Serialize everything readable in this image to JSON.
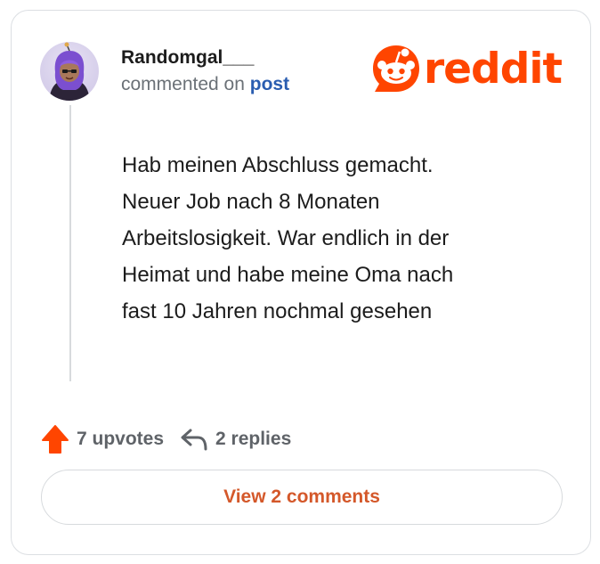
{
  "user": {
    "name": "Randomgal___",
    "subline_prefix": "commented on",
    "subline_link": "post"
  },
  "brand": {
    "logo_text": "reddit",
    "color": "#ff4500"
  },
  "comment": {
    "lines": [
      "Hab meinen Abschluss gemacht.",
      "Neuer Job nach 8 Monaten",
      "Arbeitslosigkeit. War endlich in der",
      "Heimat und habe meine Oma nach",
      "fast 10 Jahren nochmal gesehen"
    ]
  },
  "stats": {
    "upvotes": "7 upvotes",
    "replies": "2 replies",
    "upvote_icon": "upvote-arrow-icon",
    "reply_icon": "reply-arrow-icon",
    "upvote_color": "#ff4500"
  },
  "actions": {
    "view_comments": "View 2 comments",
    "view_color": "#d4582a"
  }
}
